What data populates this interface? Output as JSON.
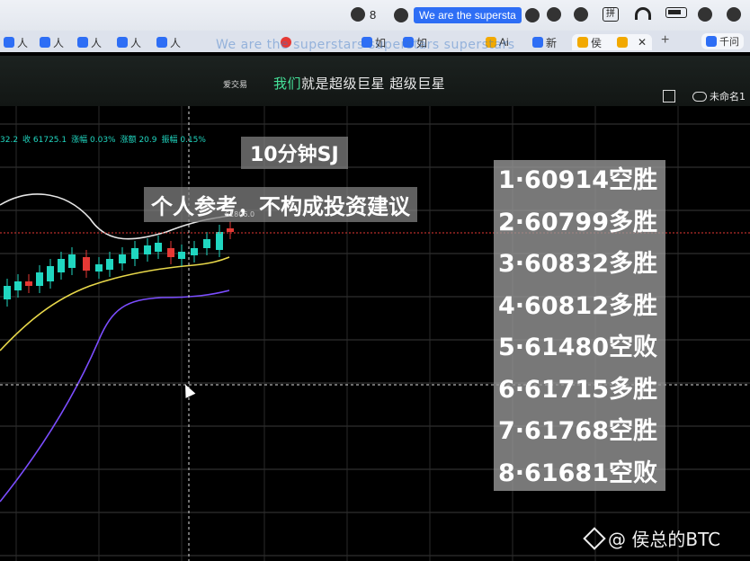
{
  "menubar": {
    "wechat_count": "8",
    "now_playing": "We are the supersta",
    "input_method": "拼"
  },
  "tabs": [
    {
      "label": "人"
    },
    {
      "label": "人"
    },
    {
      "label": "人"
    },
    {
      "label": "人"
    },
    {
      "label": "人"
    },
    {
      "label": "如"
    },
    {
      "label": "如"
    },
    {
      "label": "Ai"
    },
    {
      "label": "新"
    },
    {
      "label": "侯",
      "active": true
    }
  ],
  "extension": {
    "label": "千问"
  },
  "ghost_text": "We are the superstars superstars superstars",
  "app": {
    "brand": "爱交易",
    "slogan_highlight": "我们",
    "slogan_rest": "就是超级巨星 超级巨星",
    "cloud_label": "未命名1"
  },
  "stats": {
    "left": "32.2",
    "close": "收 61725.1",
    "change_pct": "涨幅 0.03%",
    "change_amt": "涨额 20.9",
    "amplitude": "振幅 0.15%"
  },
  "overlay": {
    "title": "10分钟SJ",
    "note": "个人参考，不构成投资建议",
    "price_tag": "61806.0"
  },
  "results": [
    "1·60914空胜",
    "2·60799多胜",
    "3·60832多胜",
    "4·60812多胜",
    "5·61480空败",
    "6·61715多胜",
    "7·61768空胜",
    "8·61681空败"
  ],
  "watermark": "@ 侯总的BTC",
  "colors": {
    "up_candle": "#20d6c0",
    "down_candle": "#e53935",
    "ma_yellow": "#e8d84a",
    "ma_purple": "#7b4dff",
    "ma_white": "#e6e6e6",
    "price_line": "#e53935"
  }
}
